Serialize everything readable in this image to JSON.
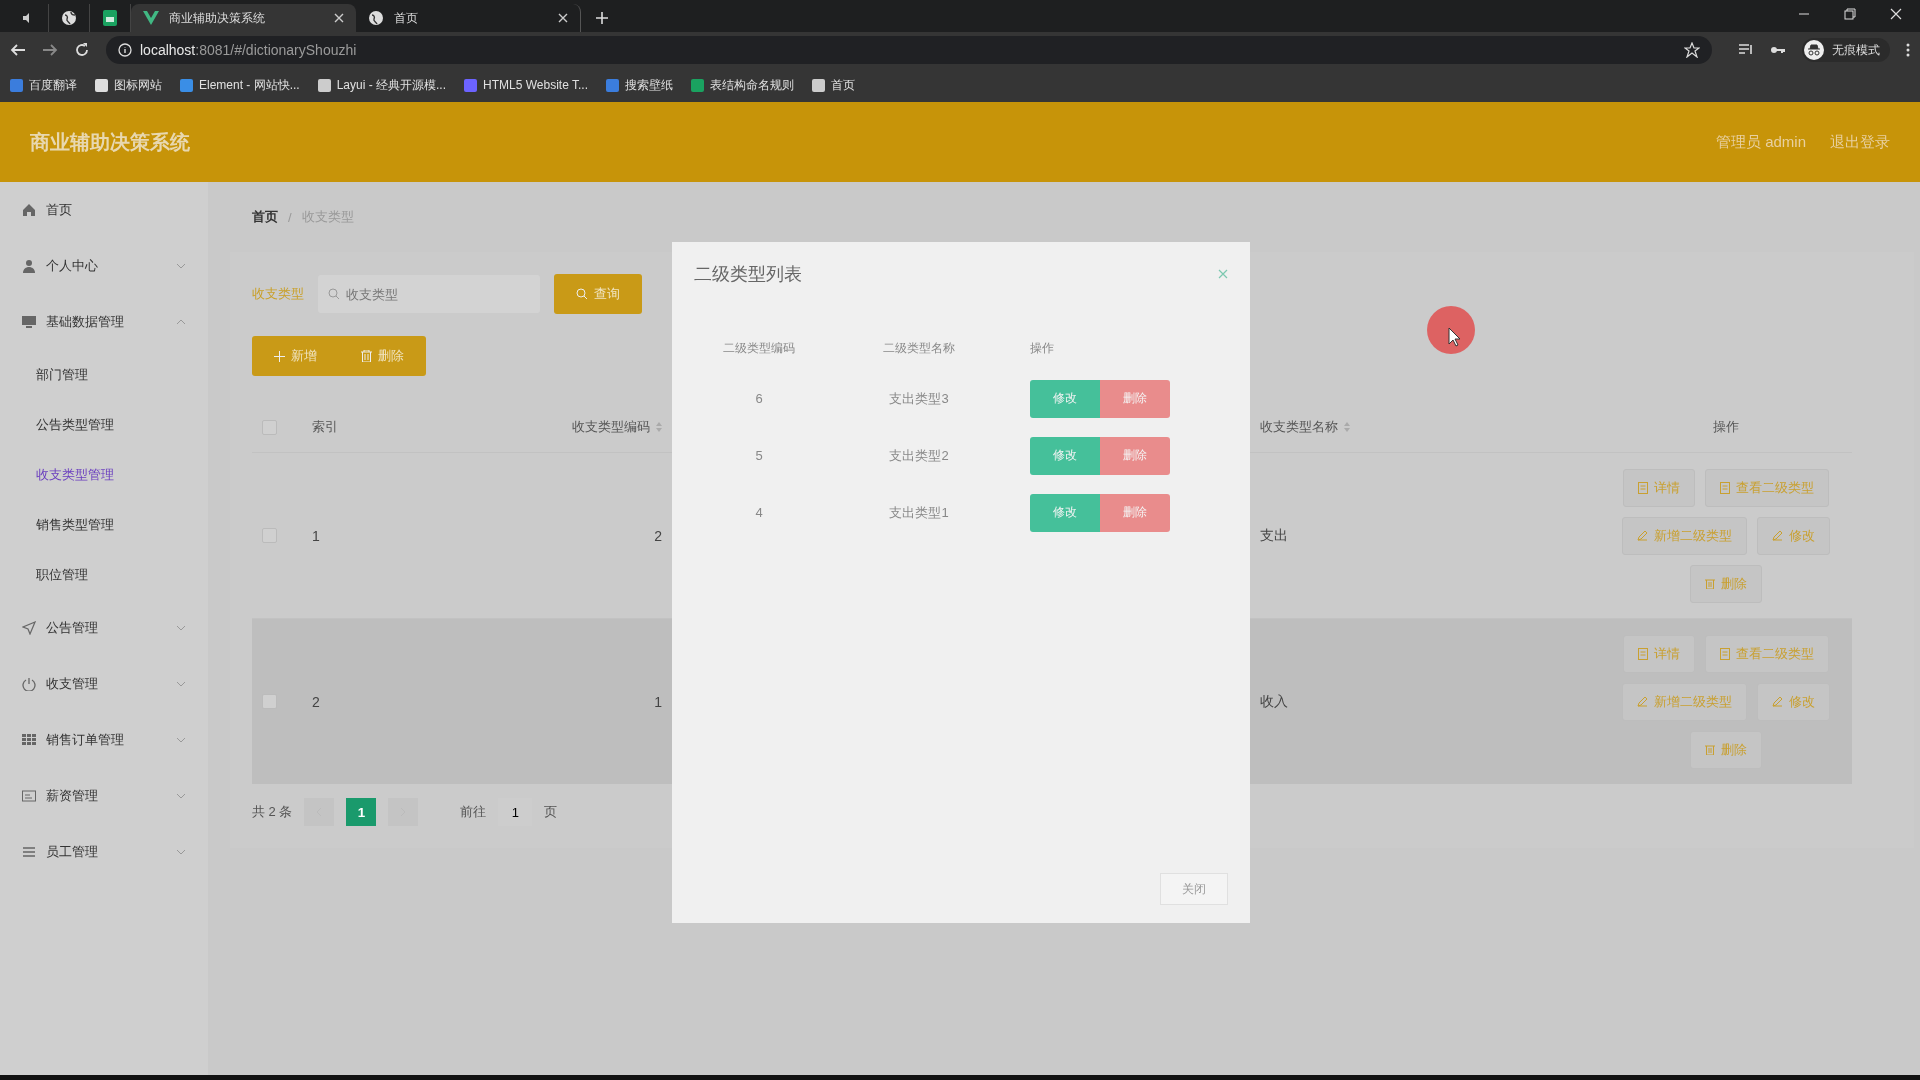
{
  "browser": {
    "tabs": [
      {
        "kind": "pinned",
        "selected": false
      },
      {
        "kind": "pinned",
        "selected": false
      },
      {
        "kind": "pinned",
        "selected": false
      },
      {
        "kind": "page",
        "title": "商业辅助决策系统",
        "selected": true
      },
      {
        "kind": "page",
        "title": "首页",
        "selected": false
      }
    ],
    "url_host": "localhost",
    "url_rest": ":8081/#/dictionaryShouzhi",
    "bookmarks": [
      "百度翻译",
      "图标网站",
      "Element - 网站快...",
      "Layui - 经典开源模...",
      "HTML5 Website T...",
      "搜索壁纸",
      "表结构命名规则",
      "首页"
    ],
    "profile_label": "无痕模式"
  },
  "header": {
    "title": "商业辅助决策系统",
    "user": "管理员 admin",
    "logout": "退出登录"
  },
  "sidebar": {
    "items": [
      {
        "label": "首页",
        "kind": "link",
        "selected": false
      },
      {
        "label": "个人中心",
        "kind": "submenu",
        "expanded": false
      },
      {
        "label": "基础数据管理",
        "kind": "submenu",
        "expanded": true,
        "children": [
          {
            "label": "部门管理",
            "selected": false
          },
          {
            "label": "公告类型管理",
            "selected": false
          },
          {
            "label": "收支类型管理",
            "selected": true
          },
          {
            "label": "销售类型管理",
            "selected": false
          },
          {
            "label": "职位管理",
            "selected": false
          }
        ]
      },
      {
        "label": "公告管理",
        "kind": "submenu",
        "expanded": false
      },
      {
        "label": "收支管理",
        "kind": "submenu",
        "expanded": false
      },
      {
        "label": "销售订单管理",
        "kind": "submenu",
        "expanded": false
      },
      {
        "label": "薪资管理",
        "kind": "submenu",
        "expanded": false
      },
      {
        "label": "员工管理",
        "kind": "submenu",
        "expanded": false
      }
    ]
  },
  "breadcrumb": [
    "首页",
    "收支类型"
  ],
  "breadcrumb_separator": "/",
  "search": {
    "label": "收支类型",
    "placeholder": "收支类型",
    "button": "查询"
  },
  "actions": [
    "新增",
    "删除"
  ],
  "table": {
    "all_checked": false,
    "columns": [
      {
        "label": "索引",
        "sortable": false
      },
      {
        "label": "收支类型编码",
        "sortable": true
      },
      {
        "label": "收支类型名称",
        "sortable": true
      },
      {
        "label": "操作",
        "sortable": false
      }
    ],
    "rows": [
      {
        "checked": false,
        "hovered": false,
        "index": "1",
        "code": "2",
        "name": "支出",
        "actions": [
          "详情",
          "查看二级类型",
          "新增二级类型",
          "修改",
          "删除"
        ]
      },
      {
        "checked": false,
        "hovered": true,
        "index": "2",
        "code": "1",
        "name": "收入",
        "actions": [
          "详情",
          "查看二级类型",
          "新增二级类型",
          "修改",
          "删除"
        ]
      }
    ]
  },
  "pagination": {
    "total": "共 2 条",
    "pages": [
      {
        "label": "1",
        "selected": true
      }
    ],
    "goto_label": "前往",
    "goto_value": "1",
    "suffix": "页"
  },
  "dialog": {
    "title": "二级类型列表",
    "columns": [
      "二级类型编码",
      "二级类型名称",
      "操作"
    ],
    "rows": [
      {
        "code": "6",
        "name": "支出类型3",
        "edit": "修改",
        "delete": "删除"
      },
      {
        "code": "5",
        "name": "支出类型2",
        "edit": "修改",
        "delete": "删除"
      },
      {
        "code": "4",
        "name": "支出类型1",
        "edit": "修改",
        "delete": "删除"
      }
    ],
    "close_button": "关闭"
  }
}
